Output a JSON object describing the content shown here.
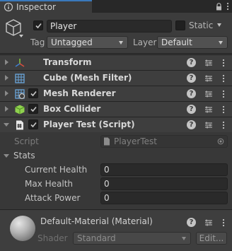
{
  "window": {
    "tab_title": "Inspector"
  },
  "gameobject": {
    "name": "Player",
    "static_label": "Static",
    "tag_label": "Tag",
    "tag_value": "Untagged",
    "layer_label": "Layer",
    "layer_value": "Default"
  },
  "components": [
    {
      "name": "Transform"
    },
    {
      "name": "Cube (Mesh Filter)"
    },
    {
      "name": "Mesh Renderer"
    },
    {
      "name": "Box Collider"
    },
    {
      "name": "Player Test (Script)"
    }
  ],
  "script": {
    "script_label": "Script",
    "script_value": "PlayerTest",
    "stats_label": "Stats",
    "fields": [
      {
        "label": "Current Health",
        "value": "0"
      },
      {
        "label": "Max Health",
        "value": "0"
      },
      {
        "label": "Attack Power",
        "value": "0"
      }
    ]
  },
  "material": {
    "name": "Default-Material (Material)",
    "shader_label": "Shader",
    "shader_value": "Standard",
    "edit_label": "Edit..."
  },
  "colors": {
    "accent": "#3a79bb",
    "check": "#c8c8c8"
  }
}
